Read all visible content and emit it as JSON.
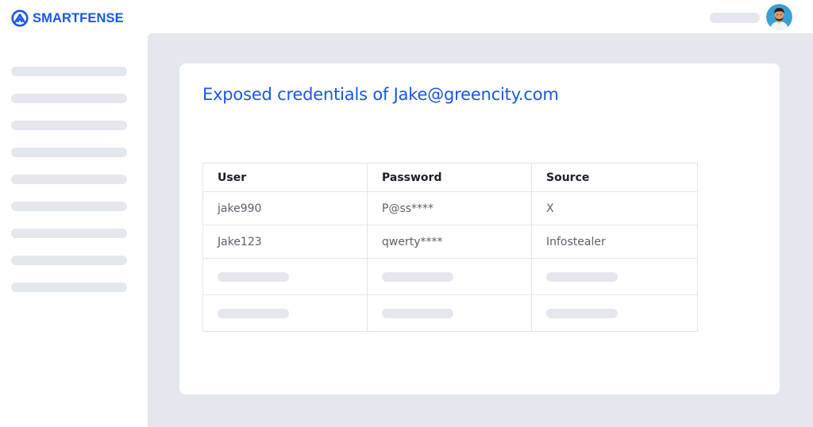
{
  "brand": {
    "name": "SMARTFENSE"
  },
  "header": {
    "avatar_alt": "User avatar"
  },
  "sidebar": {
    "placeholder_count": 9
  },
  "card": {
    "title": "Exposed credentials of Jake@greencity.com",
    "table": {
      "columns": [
        "User",
        "Password",
        "Source"
      ],
      "rows": [
        {
          "user": "jake990",
          "password": "P@ss****",
          "source": "X"
        },
        {
          "user": "Jake123",
          "password": "qwerty****",
          "source": "Infostealer"
        }
      ],
      "placeholder_rows": 2
    }
  },
  "colors": {
    "accent": "#1a56e8",
    "placeholder": "#e4e7ee",
    "panel": "#e4e7ee"
  }
}
